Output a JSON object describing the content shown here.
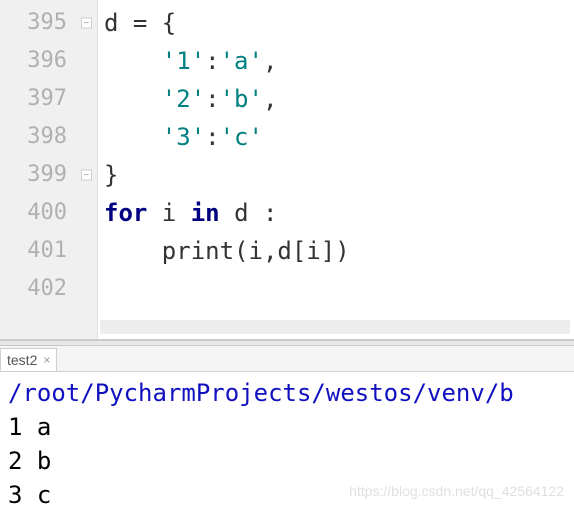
{
  "editor": {
    "lines": [
      {
        "num": "395",
        "fold": "down",
        "tokens": [
          {
            "t": "d = {",
            "c": "default"
          }
        ]
      },
      {
        "num": "396",
        "fold": "",
        "tokens": [
          {
            "t": "    ",
            "c": "default"
          },
          {
            "t": "'1'",
            "c": "string"
          },
          {
            "t": ":",
            "c": "default"
          },
          {
            "t": "'a'",
            "c": "string"
          },
          {
            "t": ",",
            "c": "default"
          }
        ]
      },
      {
        "num": "397",
        "fold": "",
        "tokens": [
          {
            "t": "    ",
            "c": "default"
          },
          {
            "t": "'2'",
            "c": "string"
          },
          {
            "t": ":",
            "c": "default"
          },
          {
            "t": "'b'",
            "c": "string"
          },
          {
            "t": ",",
            "c": "default"
          }
        ]
      },
      {
        "num": "398",
        "fold": "",
        "tokens": [
          {
            "t": "    ",
            "c": "default"
          },
          {
            "t": "'3'",
            "c": "string"
          },
          {
            "t": ":",
            "c": "default"
          },
          {
            "t": "'c'",
            "c": "string"
          }
        ]
      },
      {
        "num": "399",
        "fold": "up",
        "tokens": [
          {
            "t": "}",
            "c": "default"
          }
        ]
      },
      {
        "num": "400",
        "fold": "",
        "tokens": [
          {
            "t": "for ",
            "c": "keyword"
          },
          {
            "t": "i ",
            "c": "default"
          },
          {
            "t": "in ",
            "c": "keyword"
          },
          {
            "t": "d :",
            "c": "default"
          }
        ]
      },
      {
        "num": "401",
        "fold": "",
        "tokens": [
          {
            "t": "    print(i,d[i])",
            "c": "builtin"
          }
        ]
      },
      {
        "num": "402",
        "fold": "",
        "tokens": []
      }
    ]
  },
  "tab": {
    "label": "test2",
    "close": "×"
  },
  "terminal": {
    "path": "/root/PycharmProjects/westos/venv/b",
    "output": [
      "1 a",
      "2 b",
      "3 c"
    ]
  },
  "watermark": "https://blog.csdn.net/qq_42564122"
}
